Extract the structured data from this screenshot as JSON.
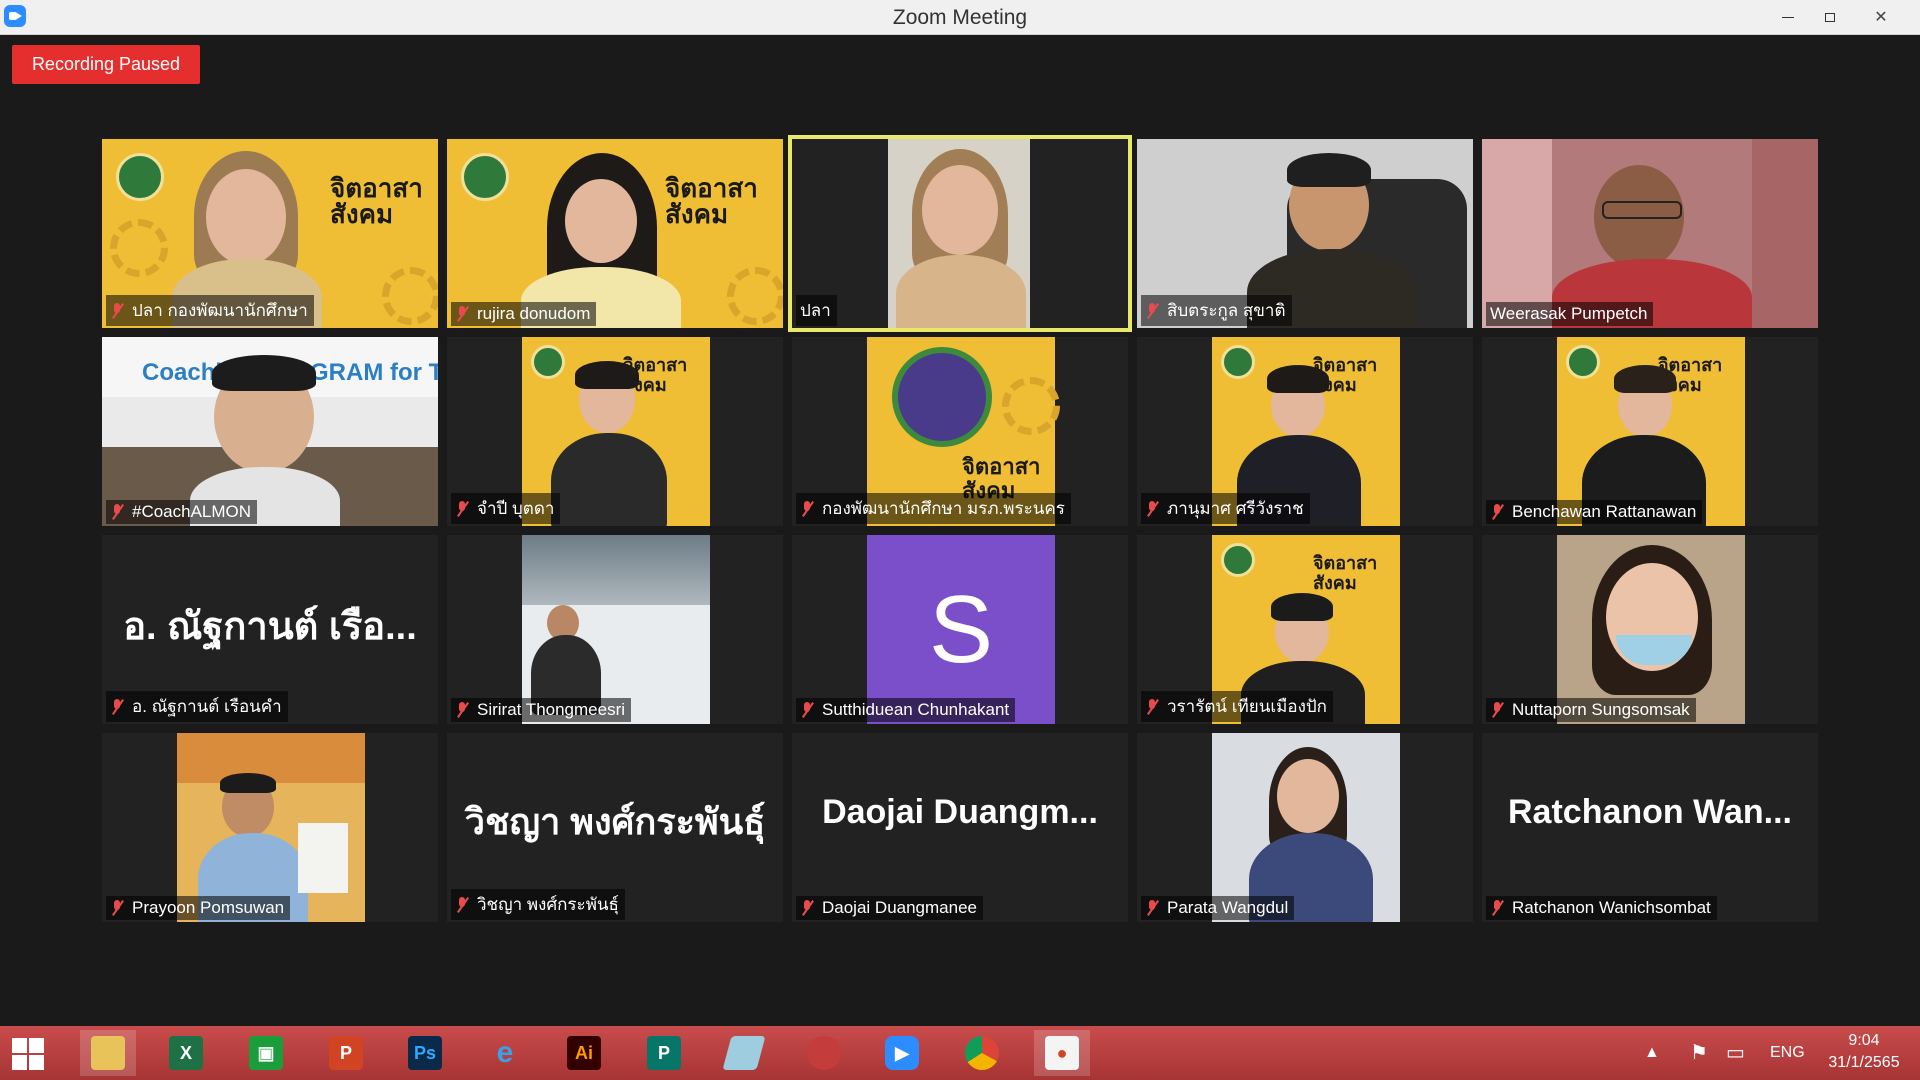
{
  "window": {
    "title": "Zoom Meeting"
  },
  "recording": {
    "label": "Recording Paused"
  },
  "participants": [
    {
      "name": "ปลา กองพัฒนานักศึกษา",
      "muted": true
    },
    {
      "name": "rujira donudom",
      "muted": true
    },
    {
      "name": "ปลา",
      "muted": false,
      "active_speaker": true
    },
    {
      "name": "สิบตระกูล สุขาติ",
      "muted": true
    },
    {
      "name": "Weerasak Pumpetch",
      "muted": false
    },
    {
      "name": "#CoachALMON",
      "muted": true
    },
    {
      "name": "จำปี บุตดา",
      "muted": true
    },
    {
      "name": "กองพัฒนานักศึกษา มรภ.พระนคร",
      "muted": true
    },
    {
      "name": "ภานุมาศ ศรีวังราช",
      "muted": true
    },
    {
      "name": "Benchawan Rattanawan",
      "muted": true
    },
    {
      "name": "อ. ณัฐกานต์ เรือนคำ",
      "muted": true,
      "display_text": "อ. ณัฐกานต์ เรือ..."
    },
    {
      "name": "Sirirat Thongmeesri",
      "muted": true
    },
    {
      "name": "Sutthiduean Chunhakant",
      "muted": true,
      "avatar_letter": "S"
    },
    {
      "name": "วรารัตน์ เทียนเมืองปัก",
      "muted": true
    },
    {
      "name": "Nuttaporn Sungsomsak",
      "muted": true
    },
    {
      "name": "Prayoon Pomsuwan",
      "muted": true
    },
    {
      "name": "วิชญา พงศ์กระพันธุ์",
      "muted": true,
      "display_text": "วิชญา พงศ์กระพันธุ์"
    },
    {
      "name": "Daojai Duangmanee",
      "muted": true,
      "display_text": "Daojai  Duangm..."
    },
    {
      "name": "Parata Wangdul",
      "muted": true
    },
    {
      "name": "Ratchanon Wanichsombat",
      "muted": true,
      "display_text": "Ratchanon  Wan..."
    }
  ],
  "banner": {
    "line1": "จิตอาสา",
    "line2": "สังคม"
  },
  "coach_banner": {
    "text": "Coaching PROGRAM for Trainer"
  },
  "taskbar": {
    "apps": [
      "file-explorer",
      "excel",
      "store",
      "powerpoint",
      "photoshop",
      "internet-explorer",
      "illustrator",
      "publisher",
      "eraser",
      "photoscape",
      "zoom",
      "chrome",
      "paint"
    ],
    "language": "ENG",
    "time": "9:04",
    "date": "31/1/2565"
  },
  "colors": {
    "recording": "#e52e2e",
    "active_border": "#e8e86a",
    "taskbar": "#b83e3e",
    "avatar_purple": "#7b4fc9"
  }
}
